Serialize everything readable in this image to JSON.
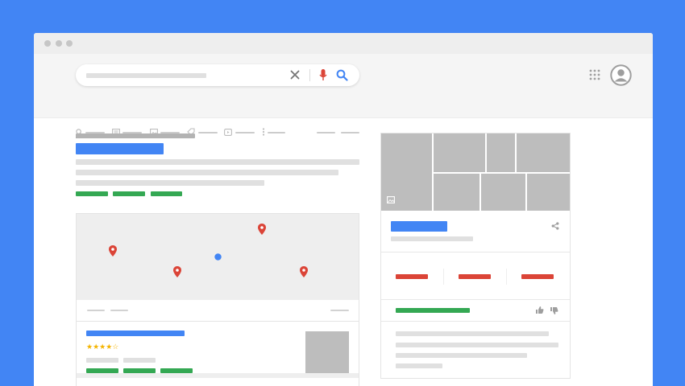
{
  "colors": {
    "background": "#4285f4",
    "brand_blue": "#4285f4",
    "brand_red": "#db4437",
    "brand_green": "#34a853",
    "brand_yellow": "#f4b400",
    "placeholder": "#e0e0e0",
    "image_placeholder": "#bdbdbd"
  },
  "browser": {
    "window_controls": [
      "window-dot-icon",
      "window-dot-icon",
      "window-dot-icon"
    ]
  },
  "search": {
    "placeholder": "",
    "icons": [
      "clear-icon",
      "microphone-icon",
      "search-icon"
    ]
  },
  "header": {
    "icons": [
      "apps-grid-icon",
      "account-icon"
    ]
  },
  "tabs": {
    "icons": [
      "search-icon",
      "news-icon",
      "image-icon",
      "tag-icon",
      "video-icon",
      "more-icon"
    ],
    "active_index": 0
  },
  "results": {
    "map_markers": [
      "map-pin-icon",
      "map-pin-icon",
      "map-pin-icon",
      "map-pin-icon"
    ],
    "current_location_icon": "location-dot-icon",
    "listing": {
      "rating_stars": "★★★★☆"
    }
  },
  "knowledge_panel": {
    "icons": [
      "image-icon",
      "share-icon",
      "thumbs-up-icon",
      "thumbs-down-icon"
    ]
  }
}
